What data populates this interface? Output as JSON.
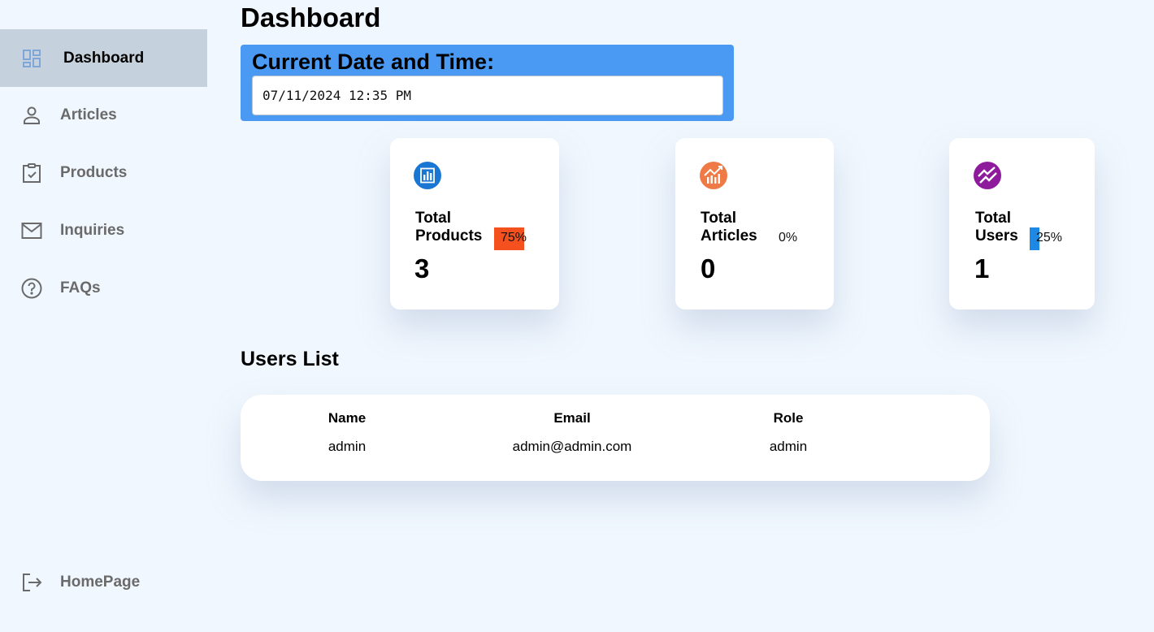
{
  "sidebar": {
    "items": [
      {
        "label": "Dashboard",
        "icon": "dashboard-icon",
        "active": true
      },
      {
        "label": "Articles",
        "icon": "user-icon"
      },
      {
        "label": "Products",
        "icon": "clipboard-check-icon"
      },
      {
        "label": "Inquiries",
        "icon": "mail-icon"
      },
      {
        "label": "FAQs",
        "icon": "help-circle-icon"
      }
    ],
    "footer": {
      "label": "HomePage",
      "icon": "logout-icon"
    }
  },
  "page_title": "Dashboard",
  "datetime": {
    "title": "Current Date and Time:",
    "value": "07/11/2024 12:35 PM"
  },
  "stats": [
    {
      "label_line1": "Total",
      "label_line2": "Products",
      "percent_label": "75%",
      "percent": 75,
      "value": "3",
      "color": "#f4511e",
      "icon": "bar-chart-icon"
    },
    {
      "label_line1": "Total",
      "label_line2": "Articles",
      "percent_label": "0%",
      "percent": 0,
      "value": "0",
      "color": "#f07a45",
      "icon": "trend-up-icon"
    },
    {
      "label_line1": "Total",
      "label_line2": "Users",
      "percent_label": "25%",
      "percent": 25,
      "value": "1",
      "color": "#1e88e5",
      "icon": "zigzag-icon"
    }
  ],
  "users": {
    "title": "Users List",
    "columns": [
      "Name",
      "Email",
      "Role"
    ],
    "rows": [
      [
        "admin",
        "admin@admin.com",
        "admin"
      ]
    ]
  },
  "colors": {
    "background": "#f0f7fe",
    "sidebar_active": "#c5d1dc",
    "datetime_box": "#4a9af4",
    "products_icon": "#1976d2",
    "articles_icon": "#f07a45",
    "users_icon": "#8e1b9c"
  }
}
